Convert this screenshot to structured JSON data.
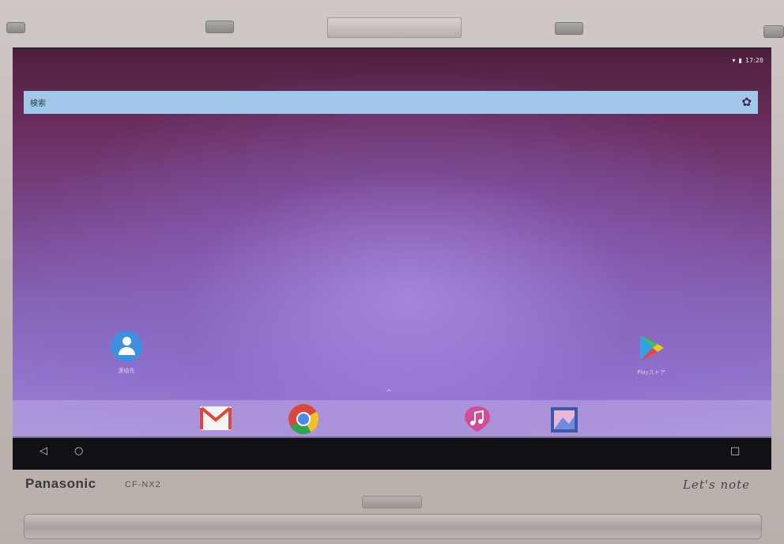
{
  "status_bar": {
    "time": "17:28",
    "icons": [
      "wifi-icon",
      "battery-icon"
    ]
  },
  "search": {
    "label": "検索",
    "settings_icon": "gear-icon"
  },
  "home_apps": [
    {
      "label": "連絡先",
      "icon": "contacts-icon"
    },
    {
      "label": "Playストア",
      "icon": "play-store-icon"
    }
  ],
  "dock": [
    "gmail-icon",
    "chrome-icon",
    "music-icon",
    "gallery-icon"
  ],
  "navbar": {
    "back": "◁",
    "home": "○",
    "recents": "□"
  },
  "device": {
    "brand": "Panasonic",
    "model": "CF-NX2",
    "series": "Let's note"
  },
  "colors": {
    "search_bar": "#9fc8ea",
    "contacts": "#3d8fe0",
    "wallpaper_top": "#4e1f3c",
    "wallpaper_bottom": "#9a86d6"
  }
}
